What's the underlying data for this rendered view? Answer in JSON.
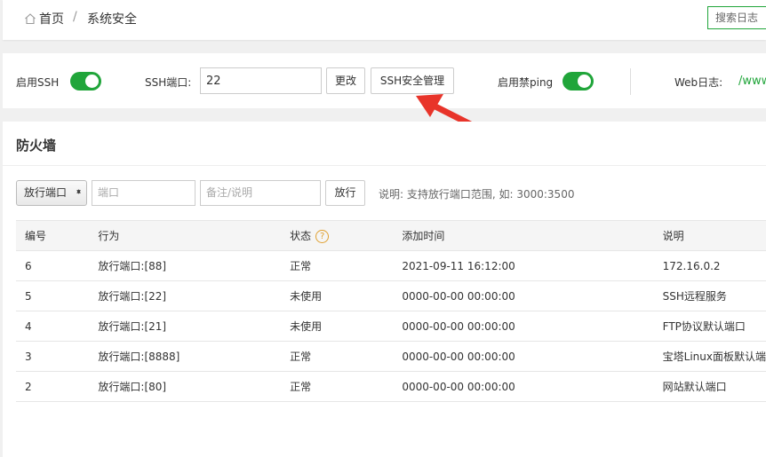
{
  "breadcrumb": {
    "home": "首页",
    "separator": "/",
    "current": "系统安全"
  },
  "search": {
    "label": "搜索日志"
  },
  "config": {
    "ssh_label": "启用SSH",
    "ssh_port_label": "SSH端口:",
    "ssh_port_value": "22",
    "change_button": "更改",
    "ssh_manage_button": "SSH安全管理",
    "ping_label": "启用禁ping",
    "web_log_label": "Web日志:",
    "web_log_path": "/www",
    "accent_color": "#20a53a",
    "arrow_color": "#e8342a"
  },
  "firewall": {
    "title": "防火墙",
    "select_value": "放行端口",
    "port_placeholder": "端口",
    "remark_placeholder": "备注/说明",
    "allow_button": "放行",
    "note": "说明: 支持放行端口范围, 如: 3000:3500",
    "columns": [
      "编号",
      "行为",
      "状态",
      "添加时间",
      "说明"
    ],
    "rows": [
      [
        "6",
        "放行端口:[88]",
        "正常",
        "2021-09-11 16:12:00",
        "172.16.0.2"
      ],
      [
        "5",
        "放行端口:[22]",
        "未使用",
        "0000-00-00 00:00:00",
        "SSH远程服务"
      ],
      [
        "4",
        "放行端口:[21]",
        "未使用",
        "0000-00-00 00:00:00",
        "FTP协议默认端口"
      ],
      [
        "3",
        "放行端口:[8888]",
        "正常",
        "0000-00-00 00:00:00",
        "宝塔Linux面板默认端"
      ],
      [
        "2",
        "放行端口:[80]",
        "正常",
        "0000-00-00 00:00:00",
        "网站默认端口"
      ]
    ]
  }
}
